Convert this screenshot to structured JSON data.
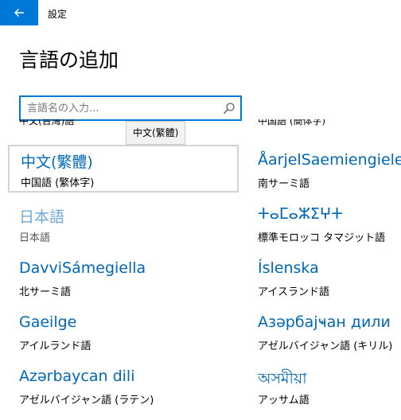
{
  "app": {
    "title": "設定"
  },
  "page": {
    "title": "言語の追加"
  },
  "search": {
    "placeholder": "言語名の入力..."
  },
  "tooltip": "中文(繁體)",
  "clipped": {
    "left": "中文(台灣)語",
    "right": "中国語 (簡体字)"
  },
  "languages": [
    {
      "name": "中文(繁體)",
      "sub": "中国語 (繁体字)"
    },
    {
      "name": "ÅarjelSaemiengiele",
      "sub": "南サーミ語"
    },
    {
      "name": "日本語",
      "sub": "日本語"
    },
    {
      "name": "ⵜⴰⵎⴰⵣⵉⵖⵜ",
      "sub": "標準モロッコ タマジット語"
    },
    {
      "name": "DavviSámegiella",
      "sub": "北サーミ語"
    },
    {
      "name": "Íslenska",
      "sub": "アイスランド語"
    },
    {
      "name": "Gaeilge",
      "sub": "アイルランド語"
    },
    {
      "name": "Азәрбајҹан дили",
      "sub": "アゼルバイジャン語 (キリル)"
    },
    {
      "name": "Azərbaycan dili",
      "sub": "アゼルバイジャン語 (ラテン)"
    },
    {
      "name": "অসমীয়া",
      "sub": "アッサム語"
    }
  ]
}
